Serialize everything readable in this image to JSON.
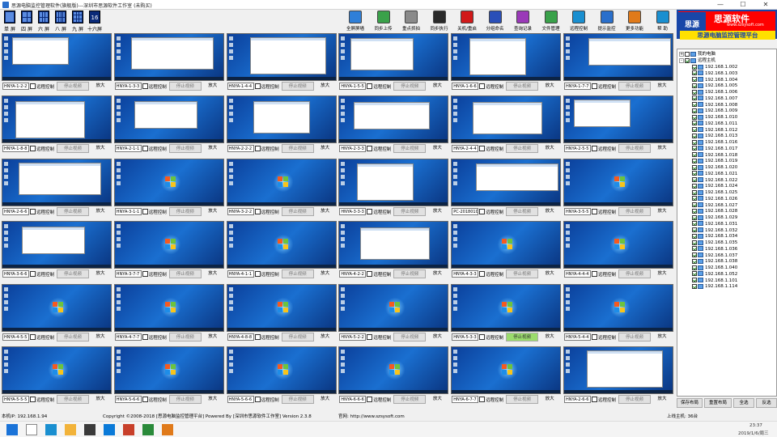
{
  "window": {
    "title": "思源电脑监控管理软件(旗舰版)---深圳市思源软件工作室 (未购买)"
  },
  "window_controls": {
    "minimize": "—",
    "maximize": "☐",
    "close": "✕"
  },
  "layouts": [
    {
      "label": "单 屏",
      "icon": "layout-1-icon",
      "cols": 1,
      "rows": 1
    },
    {
      "label": "四 屏",
      "icon": "layout-4-icon",
      "cols": 2,
      "rows": 2
    },
    {
      "label": "六 屏",
      "icon": "layout-6-icon",
      "cols": 3,
      "rows": 2
    },
    {
      "label": "八 屏",
      "icon": "layout-8-icon",
      "cols": 4,
      "rows": 2
    },
    {
      "label": "九 屏",
      "icon": "layout-9-icon",
      "cols": 3,
      "rows": 3
    },
    {
      "label": "十六屏",
      "icon": "layout-16-icon",
      "text": "16"
    }
  ],
  "toolbar": [
    {
      "label": "全屏屏墙",
      "icon": "screen-wall-icon",
      "color": "#2f7fd8"
    },
    {
      "label": "同步上传",
      "icon": "upload-icon",
      "color": "#3aa14a"
    },
    {
      "label": "重点抓拍",
      "icon": "camera-icon",
      "color": "#8a8a8a"
    },
    {
      "label": "同步执行",
      "icon": "execute-icon",
      "color": "#2a2a2a"
    },
    {
      "label": "关机/重启",
      "icon": "power-icon",
      "color": "#d11a1a"
    },
    {
      "label": "分组命名",
      "icon": "group-icon",
      "color": "#2a4fb8"
    },
    {
      "label": "查询记录",
      "icon": "records-icon",
      "color": "#9a3ab8"
    },
    {
      "label": "文件管理",
      "icon": "folder-icon",
      "color": "#3aa14a"
    },
    {
      "label": "远程控制",
      "icon": "remote-control-icon",
      "color": "#1a8fd0"
    },
    {
      "label": "提示监控",
      "icon": "monitor-alert-icon",
      "color": "#2a6fcb"
    },
    {
      "label": "更多功能",
      "icon": "more-icon",
      "color": "#e07a1a"
    },
    {
      "label": "帮 助",
      "icon": "help-icon",
      "color": "#1a8fd0"
    }
  ],
  "logo": {
    "badge": "思源",
    "name": "思源软件",
    "url": "www.szsysoft.com",
    "slogan": "思源电脑监控管理平台"
  },
  "grid": {
    "control_label": "远程控制",
    "stop_label": "停止视频",
    "zoom_label": "放大",
    "cells": [
      {
        "name": "HNYA-1-2-2",
        "kind": "app",
        "active": false
      },
      {
        "name": "HNYA-1-3-3",
        "kind": "app",
        "active": false
      },
      {
        "name": "HNYA-1-4-4",
        "kind": "app",
        "active": false
      },
      {
        "name": "HNYA-1-5-5",
        "kind": "app",
        "active": false
      },
      {
        "name": "HNYA-1-6-6",
        "kind": "app",
        "active": false
      },
      {
        "name": "HNYA-1-7-7",
        "kind": "app",
        "active": false
      },
      {
        "name": "HNYA-1-8-8",
        "kind": "app",
        "active": false
      },
      {
        "name": "HNYA-2-1-1",
        "kind": "app",
        "active": false
      },
      {
        "name": "HNYA-2-2-2",
        "kind": "app",
        "active": false
      },
      {
        "name": "HNYA-2-3-3",
        "kind": "app",
        "active": false
      },
      {
        "name": "HNYA-2-4-4",
        "kind": "app",
        "active": false
      },
      {
        "name": "HNYA-2-5-5",
        "kind": "app",
        "active": false
      },
      {
        "name": "HNYA-2-6-6",
        "kind": "app",
        "active": false
      },
      {
        "name": "HNYA-3-1-1",
        "kind": "desk",
        "active": false
      },
      {
        "name": "HNYA-3-2-2",
        "kind": "desk",
        "active": false
      },
      {
        "name": "HNYA-3-3-3",
        "kind": "app",
        "active": false
      },
      {
        "name": "PC-2018010",
        "kind": "app",
        "active": false
      },
      {
        "name": "HNYA-3-5-5",
        "kind": "desk",
        "active": false
      },
      {
        "name": "HNYA-3-6-6",
        "kind": "app",
        "active": false
      },
      {
        "name": "HNYA-3-7-7",
        "kind": "desk",
        "active": false
      },
      {
        "name": "HNYA-4-1-1",
        "kind": "desk",
        "active": false
      },
      {
        "name": "HNYA-4-2-2",
        "kind": "app",
        "active": false
      },
      {
        "name": "HNYA-4-3-3",
        "kind": "desk",
        "active": false
      },
      {
        "name": "HNYA-4-4-4",
        "kind": "desk",
        "active": false
      },
      {
        "name": "HNYA-4-5-5",
        "kind": "desk",
        "active": false
      },
      {
        "name": "HNYA-4-7-7",
        "kind": "desk",
        "active": false
      },
      {
        "name": "HNYA-4-8-8",
        "kind": "desk",
        "active": false
      },
      {
        "name": "HNYA-5-2-2",
        "kind": "desk",
        "active": false
      },
      {
        "name": "HNYA-5-3-3",
        "kind": "desk",
        "active": true
      },
      {
        "name": "HNYA-5-4-4",
        "kind": "desk",
        "active": false
      },
      {
        "name": "HNYA-5-5-5",
        "kind": "desk",
        "active": false
      },
      {
        "name": "HNYA-5-6-6",
        "kind": "desk",
        "active": false
      },
      {
        "name": "HNYA-5-6-6",
        "kind": "desk",
        "active": false
      },
      {
        "name": "HNYA-6-6-6",
        "kind": "desk",
        "active": false
      },
      {
        "name": "HNYA-6-7-7",
        "kind": "desk",
        "active": false
      },
      {
        "name": "HNYA-2-6-6",
        "kind": "app",
        "active": false
      }
    ]
  },
  "tree": {
    "root1": "我的电脑",
    "root2": "远程主机",
    "hosts": [
      "192.168.1.002",
      "192.168.1.003",
      "192.168.1.004",
      "192.168.1.005",
      "192.168.1.006",
      "192.168.1.007",
      "192.168.1.008",
      "192.168.1.009",
      "192.168.1.010",
      "192.168.1.011",
      "192.168.1.012",
      "192.168.1.013",
      "192.168.1.016",
      "192.168.1.017",
      "192.168.1.018",
      "192.168.1.019",
      "192.168.1.020",
      "192.168.1.021",
      "192.168.1.022",
      "192.168.1.024",
      "192.168.1.025",
      "192.168.1.026",
      "192.168.1.027",
      "192.168.1.028",
      "192.168.1.029",
      "192.168.1.031",
      "192.168.1.032",
      "192.168.1.034",
      "192.168.1.035",
      "192.168.1.036",
      "192.168.1.037",
      "192.168.1.038",
      "192.168.1.040",
      "192.168.1.052",
      "192.168.1.101",
      "192.168.1.114"
    ]
  },
  "side_buttons": {
    "save": "保存布局",
    "reset": "重置布局",
    "select_all": "全选",
    "invert": "反选"
  },
  "status": {
    "local_ip": "本机IP: 192.168.1.94",
    "copyright": "Copyright ©2008-2018 [思源电脑监控管理平台] Powered By [深圳市思源软件工作室] Version 2.3.8",
    "site": "官网: http://www.szsysoft.com",
    "online": "上线主机: 36台"
  },
  "taskbar": {
    "icons": [
      "windows-start-icon",
      "search-icon",
      "ie-icon",
      "explorer-icon",
      "app-icon",
      "app-icon",
      "app-icon",
      "app-icon",
      "monitor-app-icon"
    ],
    "time": "23:37",
    "date": "2019/1/6/周三"
  }
}
